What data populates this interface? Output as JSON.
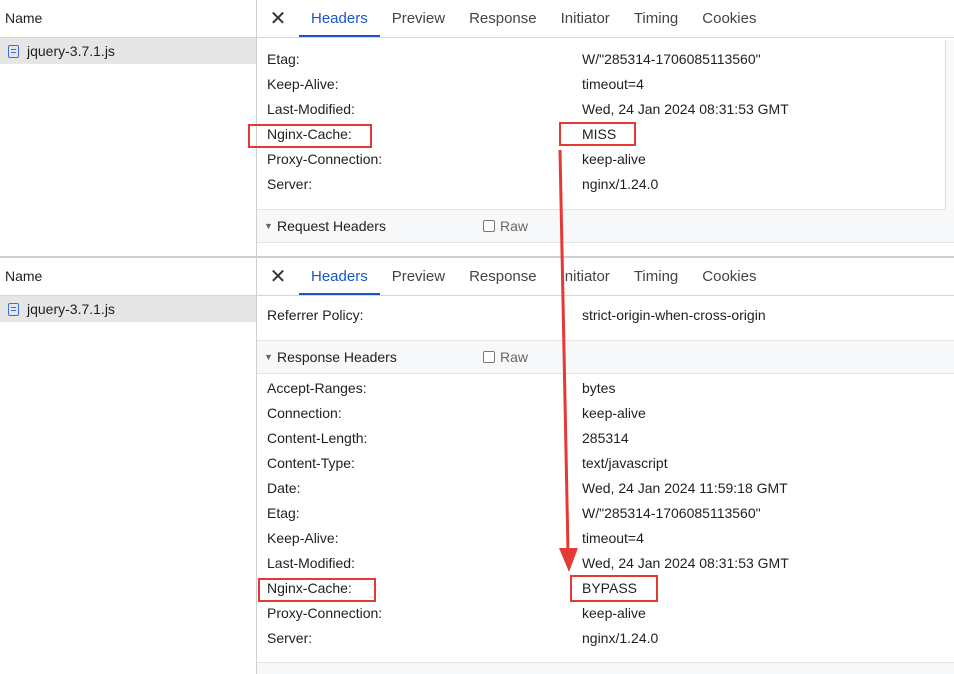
{
  "top_panel": {
    "name_header": "Name",
    "file": "jquery-3.7.1.js",
    "tabs": [
      "Headers",
      "Preview",
      "Response",
      "Initiator",
      "Timing",
      "Cookies"
    ],
    "rows": [
      {
        "key": "Etag:",
        "value": "W/\"285314-1706085113560\""
      },
      {
        "key": "Keep-Alive:",
        "value": "timeout=4"
      },
      {
        "key": "Last-Modified:",
        "value": "Wed, 24 Jan 2024 08:31:53 GMT"
      },
      {
        "key": "Nginx-Cache:",
        "value": "MISS"
      },
      {
        "key": "Proxy-Connection:",
        "value": "keep-alive"
      },
      {
        "key": "Server:",
        "value": "nginx/1.24.0"
      }
    ],
    "section": "Request Headers",
    "raw_label": "Raw"
  },
  "bottom_panel": {
    "name_header": "Name",
    "file": "jquery-3.7.1.js",
    "tabs": [
      "Headers",
      "Preview",
      "Response",
      "Initiator",
      "Timing",
      "Cookies"
    ],
    "general_rows": [
      {
        "key": "Referrer Policy:",
        "value": "strict-origin-when-cross-origin"
      }
    ],
    "section": "Response Headers",
    "raw_label": "Raw",
    "rows": [
      {
        "key": "Accept-Ranges:",
        "value": "bytes"
      },
      {
        "key": "Connection:",
        "value": "keep-alive"
      },
      {
        "key": "Content-Length:",
        "value": "285314"
      },
      {
        "key": "Content-Type:",
        "value": "text/javascript"
      },
      {
        "key": "Date:",
        "value": "Wed, 24 Jan 2024 11:59:18 GMT"
      },
      {
        "key": "Etag:",
        "value": "W/\"285314-1706085113560\""
      },
      {
        "key": "Keep-Alive:",
        "value": "timeout=4"
      },
      {
        "key": "Last-Modified:",
        "value": "Wed, 24 Jan 2024 08:31:53 GMT"
      },
      {
        "key": "Nginx-Cache:",
        "value": "BYPASS"
      },
      {
        "key": "Proxy-Connection:",
        "value": "keep-alive"
      },
      {
        "key": "Server:",
        "value": "nginx/1.24.0"
      }
    ]
  },
  "colors": {
    "accent": "#1a56c9",
    "highlight": "#e53935",
    "selected_row": "#e6e6e6",
    "file_icon": "#3b6fd9"
  },
  "icons": {
    "close": "close-icon",
    "file": "document-icon",
    "collapse": "triangle-down-icon"
  }
}
